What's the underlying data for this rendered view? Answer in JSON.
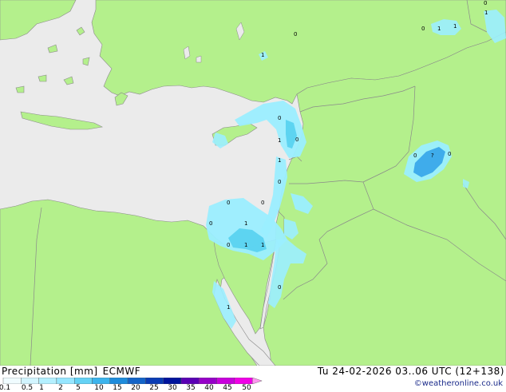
{
  "colors": {
    "sea": "#ebebeb",
    "land": "#b4f08c",
    "border": "#8a8a8a",
    "precip_light": "#9beeff",
    "precip_medium": "#5ad2f0",
    "precip_heavy": "#3aa8ea"
  },
  "map": {
    "point_values": [
      "0",
      "1",
      "0",
      "1",
      "0",
      "1",
      "1",
      "?",
      "0",
      "0",
      "1",
      "0",
      "0",
      "1",
      "0",
      "0",
      "1",
      "0",
      "0",
      "0",
      "1",
      "1",
      "0"
    ]
  },
  "legend": {
    "title": "Precipitation [mm]",
    "model": "ECMWF",
    "datetime": "Tu 24-02-2026 03..06 UTC (12+138)",
    "credit": "©weatheronline.co.uk",
    "ticks": [
      "0.1",
      "0.5",
      "1",
      "2",
      "5",
      "10",
      "15",
      "20",
      "25",
      "30",
      "35",
      "40",
      "45",
      "50"
    ],
    "colors": [
      "#f0fcff",
      "#d2f5ff",
      "#b4f0ff",
      "#96e6ff",
      "#64d2f5",
      "#3cb4ec",
      "#1e8cdc",
      "#1464c8",
      "#0a3cb4",
      "#00149c",
      "#5a00b4",
      "#9600c8",
      "#c800dc",
      "#f000e6"
    ],
    "over_color": "#ff96f0"
  }
}
